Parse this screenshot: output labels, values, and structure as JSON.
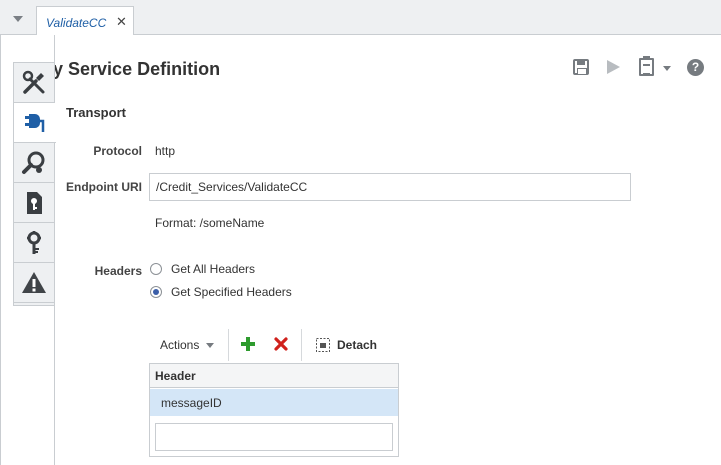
{
  "tabs": [
    {
      "label": "ValidateCC",
      "close": "✕"
    }
  ],
  "page": {
    "title": "Proxy Service Definition"
  },
  "toolbar": {
    "help": "?"
  },
  "section": {
    "title": "Transport"
  },
  "form": {
    "protocol_label": "Protocol",
    "protocol_value": "http",
    "endpoint_label": "Endpoint URI",
    "endpoint_value": "/Credit_Services/ValidateCC",
    "format_hint": "Format: /someName",
    "headers_label": "Headers",
    "headers_options": [
      {
        "label": "Get All Headers",
        "checked": false
      },
      {
        "label": "Get Specified Headers",
        "checked": true
      }
    ]
  },
  "table_toolbar": {
    "actions_label": "Actions",
    "detach_label": "Detach"
  },
  "grid": {
    "columns": [
      "Header"
    ],
    "rows": [
      {
        "header": "messageID"
      }
    ],
    "new_row_value": ""
  },
  "colors": {
    "accent": "#1f5fa6",
    "selected_row": "#d4e6f7",
    "add": "#2e9b2e",
    "delete": "#d0211c",
    "warning": "#404448"
  }
}
